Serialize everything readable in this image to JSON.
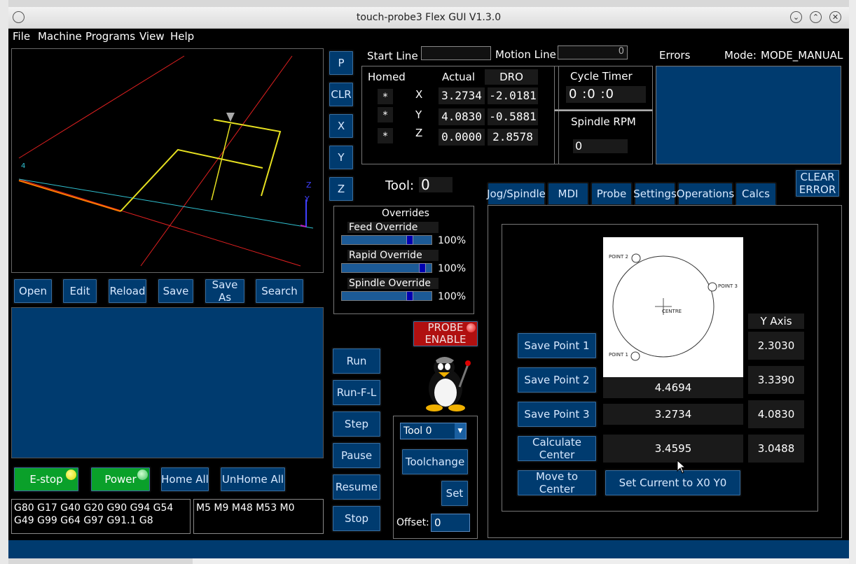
{
  "window": {
    "title": "touch-probe3 Flex GUI V1.3.0"
  },
  "menu": [
    "File",
    "Machine",
    "Programs",
    "View",
    "Help"
  ],
  "file_buttons": [
    "Open",
    "Edit",
    "Reload",
    "Save",
    "Save As",
    "Search"
  ],
  "plot": {
    "axis_z": "Z",
    "axis_y": "Y",
    "origin_mark": "4"
  },
  "side_buttons": [
    "P",
    "CLR",
    "X",
    "Y",
    "Z"
  ],
  "status_buttons": {
    "estop": "E-stop",
    "power": "Power",
    "home_all": "Home All",
    "unhome_all": "UnHome All"
  },
  "gcodes": {
    "g_modal": "G80 G17 G40 G20 G90 G94 G54 G49 G99 G64 G97 G91.1 G8",
    "m_modal": "M5 M9 M48 M53 M0"
  },
  "program_buttons": [
    "Run",
    "Run-F-L",
    "Step",
    "Pause",
    "Resume",
    "Stop"
  ],
  "header": {
    "start_line_label": "Start Line",
    "start_line_value": "",
    "motion_line_label": "Motion Line",
    "motion_line_value": "0",
    "errors_label": "Errors",
    "mode_label": "Mode:",
    "mode_value": "MODE_MANUAL"
  },
  "dro": {
    "homed_label": "Homed",
    "actual_label": "Actual",
    "dro_label": "DRO",
    "rows": [
      {
        "homed": "*",
        "axis": "X",
        "actual": "3.2734",
        "dro": "-2.0181"
      },
      {
        "homed": "*",
        "axis": "Y",
        "actual": "4.0830",
        "dro": "-0.5881"
      },
      {
        "homed": "*",
        "axis": "Z",
        "actual": "0.0000",
        "dro": "2.8578"
      }
    ]
  },
  "cycle_timer": {
    "label": "Cycle Timer",
    "h": "0",
    "m": "0",
    "s": "0",
    "sep": ":"
  },
  "spindle": {
    "label": "Spindle RPM",
    "value": "0"
  },
  "tool": {
    "label": "Tool:",
    "value": "0"
  },
  "overrides": {
    "title": "Overrides",
    "items": [
      {
        "label": "Feed Override",
        "value": "100%",
        "level": 0.77
      },
      {
        "label": "Rapid Override",
        "value": "100%",
        "level": 0.92
      },
      {
        "label": "Spindle Override",
        "value": "100%",
        "level": 0.77
      }
    ]
  },
  "probe_enable": {
    "line1": "PROBE",
    "line2": "ENABLE"
  },
  "toolchange": {
    "select_value": "Tool 0",
    "toolchange_label": "Toolchange",
    "set_label": "Set",
    "offset_label": "Offset:",
    "offset_value": "0"
  },
  "tabs": [
    "Jog/Spindle",
    "MDI",
    "Probe",
    "Settings",
    "Operations",
    "Calcs"
  ],
  "active_tab": "Calcs",
  "clear_error": {
    "line1": "CLEAR",
    "line2": "ERROR"
  },
  "calcs": {
    "diagram": {
      "point1": "POINT 1",
      "point2": "POINT 2",
      "point3": "POINT 3",
      "centre": "CENTRE"
    },
    "y_axis_label": "Y Axis",
    "buttons": [
      "Save Point 1",
      "Save Point 2",
      "Save Point 3",
      "Calculate Center",
      "Move to Center"
    ],
    "x_values": [
      "4.4694",
      "3.2734",
      "3.4595"
    ],
    "y_values": [
      "2.3030",
      "3.3390",
      "4.0830",
      "3.0488"
    ],
    "set_current": "Set Current to X0 Y0"
  },
  "colors": {
    "panel_blue": "#003b6f",
    "estop_green": "#0aa02a",
    "probe_red": "#b01010"
  }
}
